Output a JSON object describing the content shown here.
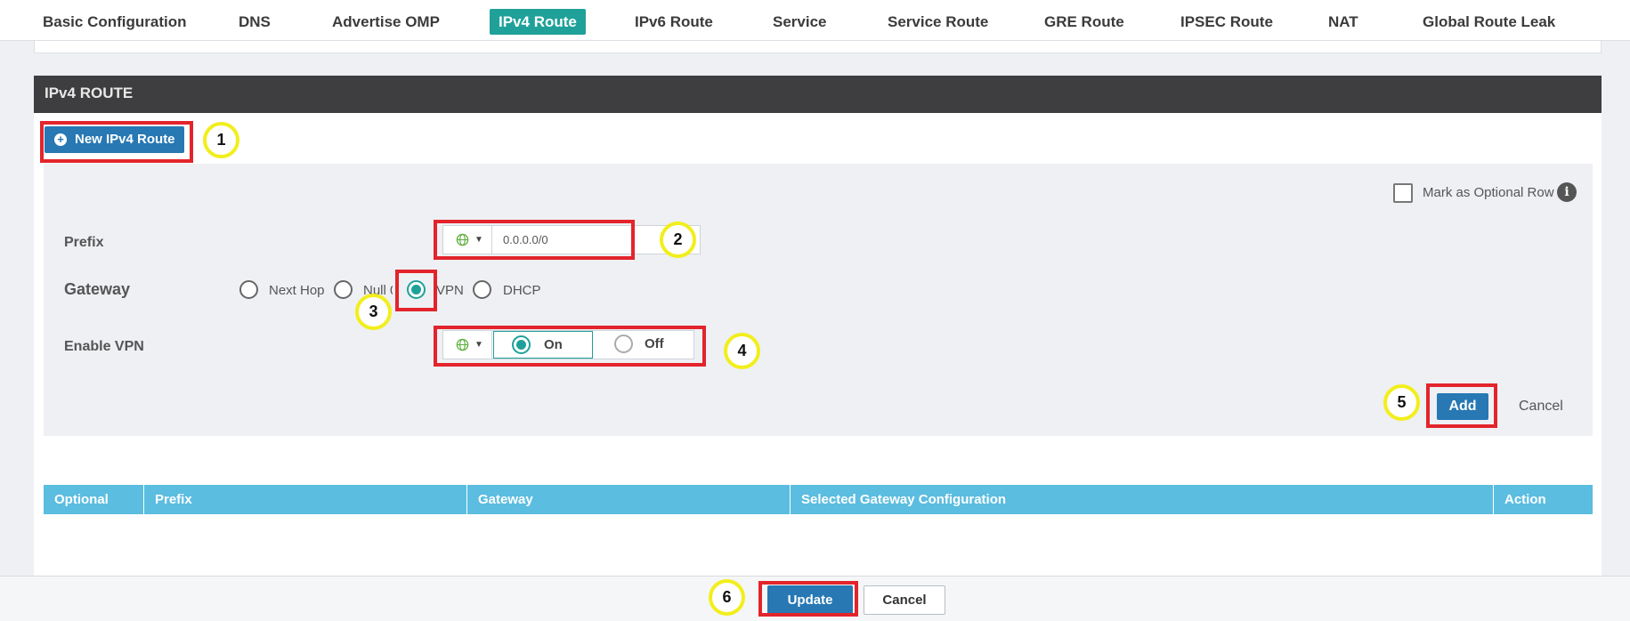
{
  "tabs": [
    {
      "label": "Basic Configuration",
      "active": false
    },
    {
      "label": "DNS",
      "active": false
    },
    {
      "label": "Advertise OMP",
      "active": false
    },
    {
      "label": "IPv4 Route",
      "active": true
    },
    {
      "label": "IPv6 Route",
      "active": false
    },
    {
      "label": "Service",
      "active": false
    },
    {
      "label": "Service Route",
      "active": false
    },
    {
      "label": "GRE Route",
      "active": false
    },
    {
      "label": "IPSEC Route",
      "active": false
    },
    {
      "label": "NAT",
      "active": false
    },
    {
      "label": "Global Route Leak",
      "active": false
    }
  ],
  "section": {
    "title": "IPv4 ROUTE",
    "new_button": "New IPv4 Route"
  },
  "form": {
    "optional_row_label": "Mark as Optional Row",
    "info_glyph": "i",
    "prefix": {
      "label": "Prefix",
      "value": "0.0.0.0/0",
      "scope_icon": "globe-icon"
    },
    "gateway": {
      "label": "Gateway",
      "options": [
        "Next Hop",
        "Null 0",
        "VPN",
        "DHCP"
      ],
      "visible_option_text": [
        "Next Hop",
        "Null 0",
        "VPN",
        "DHCP"
      ],
      "selected": "VPN"
    },
    "enable_vpn": {
      "label": "Enable VPN",
      "on": "On",
      "off": "Off",
      "selected": "On",
      "scope_icon": "globe-icon"
    },
    "add_button": "Add",
    "cancel_button": "Cancel"
  },
  "table": {
    "columns": [
      "Optional",
      "Prefix",
      "Gateway",
      "Selected Gateway Configuration",
      "Action"
    ]
  },
  "footer": {
    "update_button": "Update",
    "cancel_button": "Cancel"
  },
  "annotations": {
    "steps": [
      "1",
      "2",
      "3",
      "4",
      "5",
      "6"
    ],
    "highlight_color": "#e3242b",
    "step_circle_color": "#f2ee1d"
  },
  "colors": {
    "accent": "#1fa19a",
    "primary_button": "#2778b3",
    "table_header": "#5bbde0",
    "section_header": "#3e3e40"
  }
}
